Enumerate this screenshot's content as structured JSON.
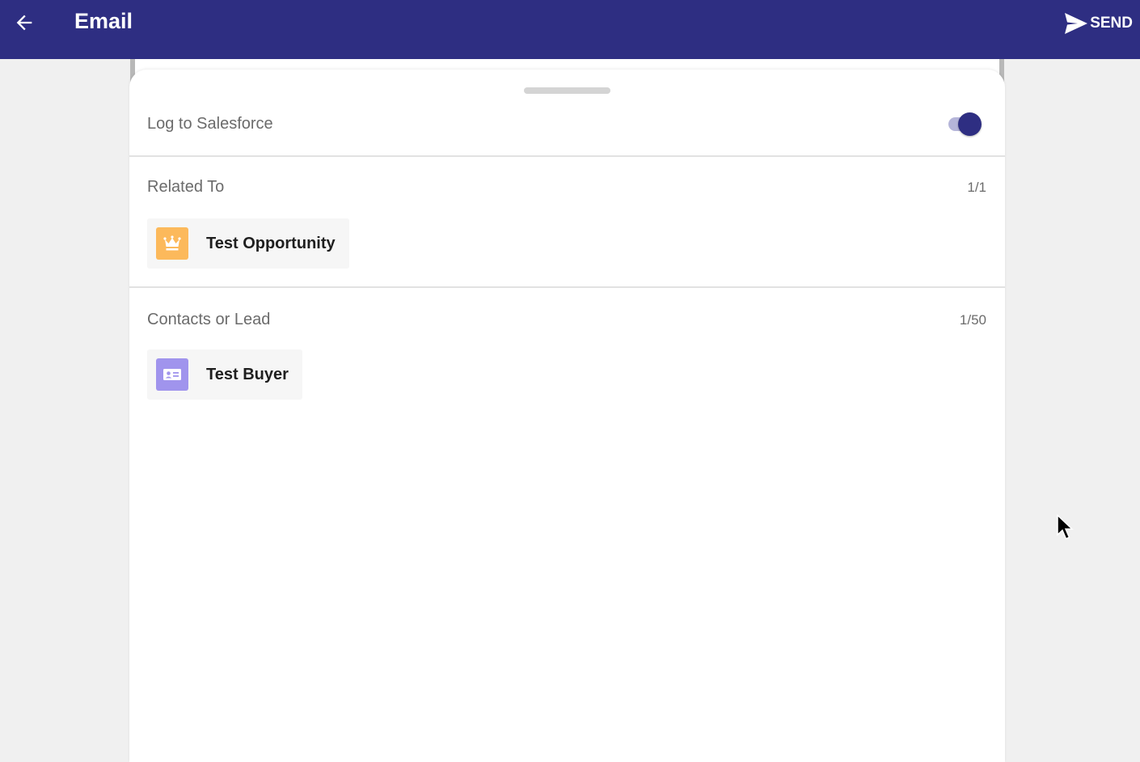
{
  "appbar": {
    "title": "Email",
    "send_label": "SEND",
    "background": "#2e2e82"
  },
  "log": {
    "label": "Log to Salesforce",
    "enabled": true
  },
  "related": {
    "label": "Related To",
    "count": "1/1",
    "item": {
      "name": "Test Opportunity",
      "icon": "crown-icon",
      "icon_color": "#fcb95b"
    }
  },
  "contacts": {
    "label": "Contacts or Lead",
    "count": "1/50",
    "item": {
      "name": "Test Buyer",
      "icon": "contact-card-icon",
      "icon_color": "#a094ed"
    }
  }
}
